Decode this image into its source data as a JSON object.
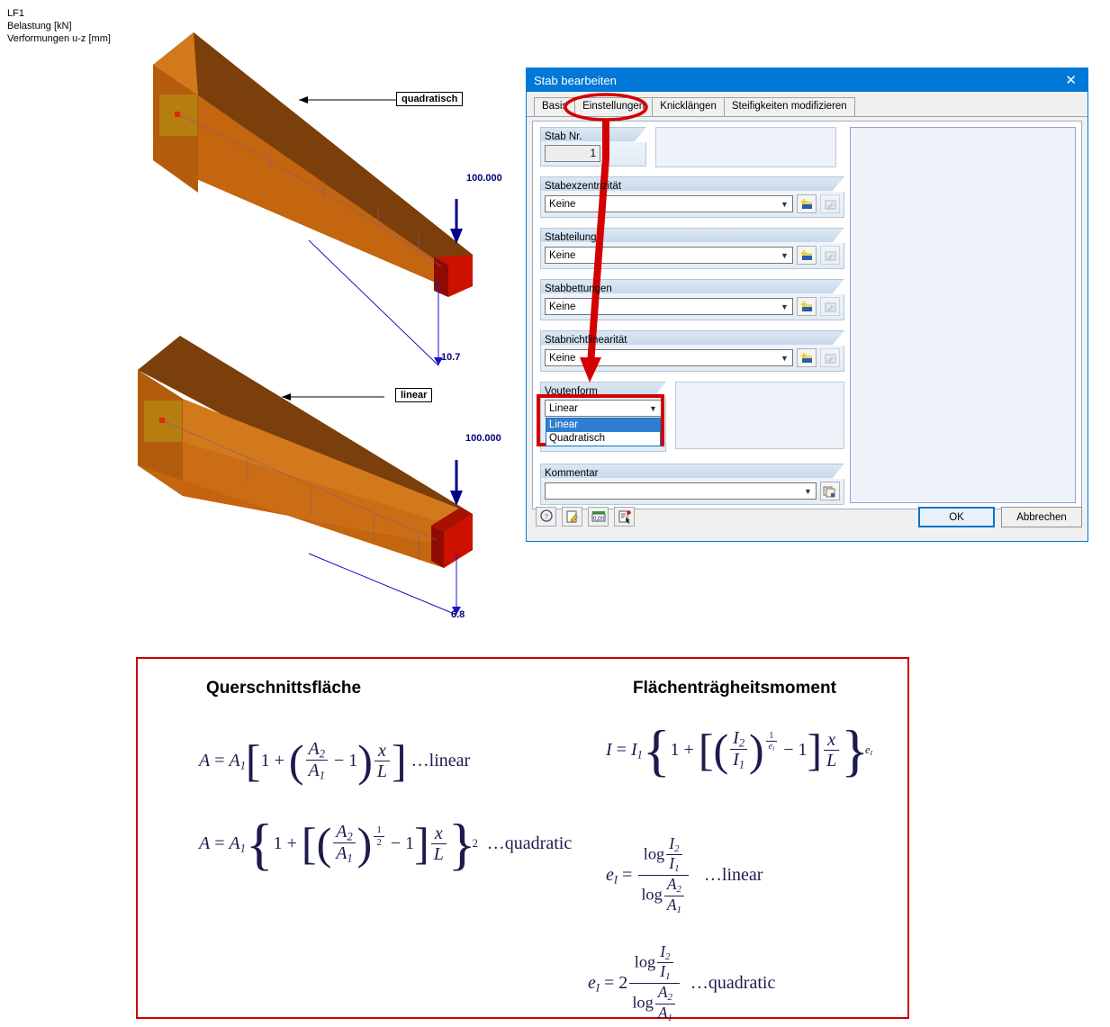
{
  "legend": {
    "line1": "LF1",
    "line2": "Belastung [kN]",
    "line3": "Verformungen u-z [mm]"
  },
  "scenes": [
    {
      "id": "quadratic-beam",
      "callout": "quadratisch",
      "load_value": "100.000",
      "deformation_value": "10.7"
    },
    {
      "id": "linear-beam",
      "callout": "linear",
      "load_value": "100.000",
      "deformation_value": "6.8"
    }
  ],
  "dialog": {
    "title": "Stab bearbeiten",
    "close_label": "✕",
    "tabs": [
      {
        "label": "Basis",
        "active": false
      },
      {
        "label": "Einstellungen",
        "active": true
      },
      {
        "label": "Knicklängen",
        "active": false
      },
      {
        "label": "Steifigkeiten modifizieren",
        "active": false
      }
    ],
    "groups": [
      {
        "label": "Stab Nr.",
        "value": "1",
        "type": "number"
      },
      {
        "label": "Stabexzentrizität",
        "value": "Keine",
        "type": "combo"
      },
      {
        "label": "Stabteilung",
        "value": "Keine",
        "type": "combo"
      },
      {
        "label": "Stabbettungen",
        "value": "Keine",
        "type": "combo"
      },
      {
        "label": "Stabnichtlinearität",
        "value": "Keine",
        "type": "combo"
      },
      {
        "label": "Voutenform",
        "value": "Linear",
        "type": "combo-open"
      },
      {
        "label": "Kommentar",
        "value": "",
        "type": "combo"
      }
    ],
    "voutenform_options": [
      {
        "label": "Linear",
        "selected": true
      },
      {
        "label": "Quadratisch",
        "selected": false
      }
    ],
    "toolbar_icons": [
      {
        "name": "help-icon",
        "glyph": "?"
      },
      {
        "name": "edit-icon",
        "glyph": "✎"
      },
      {
        "name": "number-format-icon",
        "glyph": "0,00"
      },
      {
        "name": "details-icon",
        "glyph": "☰"
      }
    ],
    "ok_label": "OK",
    "cancel_label": "Abbrechen",
    "accent_color": "#0078d7",
    "highlight_color": "#d40000"
  },
  "formulas": {
    "heading_left": "Querschnittsfläche",
    "heading_right": "Flächenträgheitsmoment",
    "area_linear": {
      "lhs": "A = A",
      "lhs_sub": "1",
      "annotation": "…linear",
      "expr": "A = A₁[1 + (A₂/A₁ − 1) x/L]"
    },
    "area_quadratic": {
      "annotation": "…quadratic",
      "expr": "A = A₁{1 + [(A₂/A₁)^(1/2) − 1] x/L}²"
    },
    "inertia": {
      "expr": "I = I₁{1 + [(I₂/I₁)^(1/e_I) − 1] x/L}^(e_I)"
    },
    "e_linear": {
      "annotation": "…linear",
      "expr": "e_I = log(I₂/I₁) / log(A₂/A₁)"
    },
    "e_quadratic": {
      "annotation": "…quadratic",
      "expr": "e_I = 2 · log(I₂/I₁) / log(A₂/A₁)"
    },
    "symbols": {
      "A": "A",
      "I": "I",
      "e": "e",
      "x": "x",
      "L": "L",
      "one": "1",
      "two": "2",
      "log": "log",
      "eq": "=",
      "plus": "+",
      "minus": "−"
    }
  },
  "colors": {
    "beam_top": "#7a3f0a",
    "beam_front": "#d2791c",
    "beam_side": "#c06010",
    "beam_end": "#cc1100",
    "load_arrow": "#00008b",
    "annotation_red": "#d40000"
  }
}
